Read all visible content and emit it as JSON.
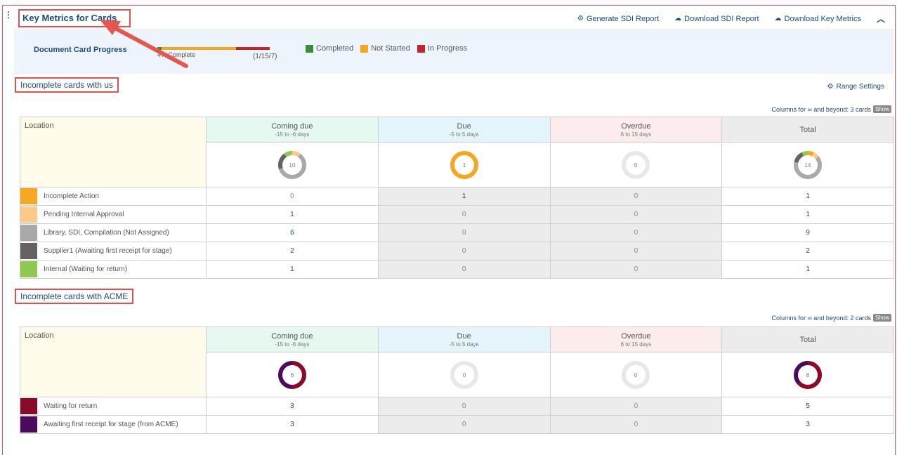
{
  "header": {
    "title": "Key Metrics for Cards",
    "actions": {
      "generate": "Generate SDI Report",
      "download_sdi": "Download SDI Report",
      "download_metrics": "Download Key Metrics"
    }
  },
  "progress": {
    "label": "Document Card Progress",
    "percent_text": "4% Complete",
    "counts": "(1/15/7)",
    "completed_fraction": 0.04,
    "in_progress_fraction": 0.3,
    "legend": [
      "Completed",
      "Not Started",
      "In Progress"
    ],
    "colors": {
      "completed": "#3a8d3a",
      "not_started": "#f5a623",
      "in_progress": "#c0272d"
    }
  },
  "section1": {
    "title": "Incomplete cards with us",
    "range_settings": "Range Settings",
    "cols_note": "Columns for ∞ and beyond: 3 cards",
    "show": "Show",
    "location": "Location",
    "columns": [
      {
        "name": "Coming due",
        "range": "-15 to -6 days",
        "donut": "10"
      },
      {
        "name": "Due",
        "range": "-5 to 5 days",
        "donut": "1"
      },
      {
        "name": "Overdue",
        "range": "6 to 15 days",
        "donut": "0"
      },
      {
        "name": "Total",
        "range": "",
        "donut": "14"
      }
    ],
    "rows": [
      {
        "label": "Incomplete Action",
        "color": "#f5a623",
        "values": [
          "0",
          "1",
          "0",
          "1"
        ]
      },
      {
        "label": "Pending Internal Approval",
        "color": "#fcc98a",
        "values": [
          "1",
          "0",
          "0",
          "1"
        ]
      },
      {
        "label": "Library, SDI, Compilation (Not Assigned)",
        "color": "#a9a9a9",
        "values": [
          "6",
          "0",
          "0",
          "9"
        ]
      },
      {
        "label": "Supplier1 (Awaiting first receipt for stage)",
        "color": "#666262",
        "values": [
          "2",
          "0",
          "0",
          "2"
        ]
      },
      {
        "label": "Internal (Waiting for return)",
        "color": "#8fc850",
        "values": [
          "1",
          "0",
          "0",
          "1"
        ]
      }
    ]
  },
  "section2": {
    "title": "Incomplete cards with ACME",
    "cols_note": "Columns for ∞ and beyond: 2 cards",
    "show": "Show",
    "location": "Location",
    "columns": [
      {
        "name": "Coming due",
        "range": "-15 to -6 days",
        "donut": "6"
      },
      {
        "name": "Due",
        "range": "-5 to 5 days",
        "donut": "0"
      },
      {
        "name": "Overdue",
        "range": "6 to 15 days",
        "donut": "0"
      },
      {
        "name": "Total",
        "range": "",
        "donut": "8"
      }
    ],
    "rows": [
      {
        "label": "Waiting for return",
        "color": "#8b0a2a",
        "values": [
          "3",
          "0",
          "0",
          "5"
        ]
      },
      {
        "label": "Awaiting first receipt for stage (from ACME)",
        "color": "#4b0a5e",
        "values": [
          "3",
          "0",
          "0",
          "3"
        ]
      }
    ]
  }
}
